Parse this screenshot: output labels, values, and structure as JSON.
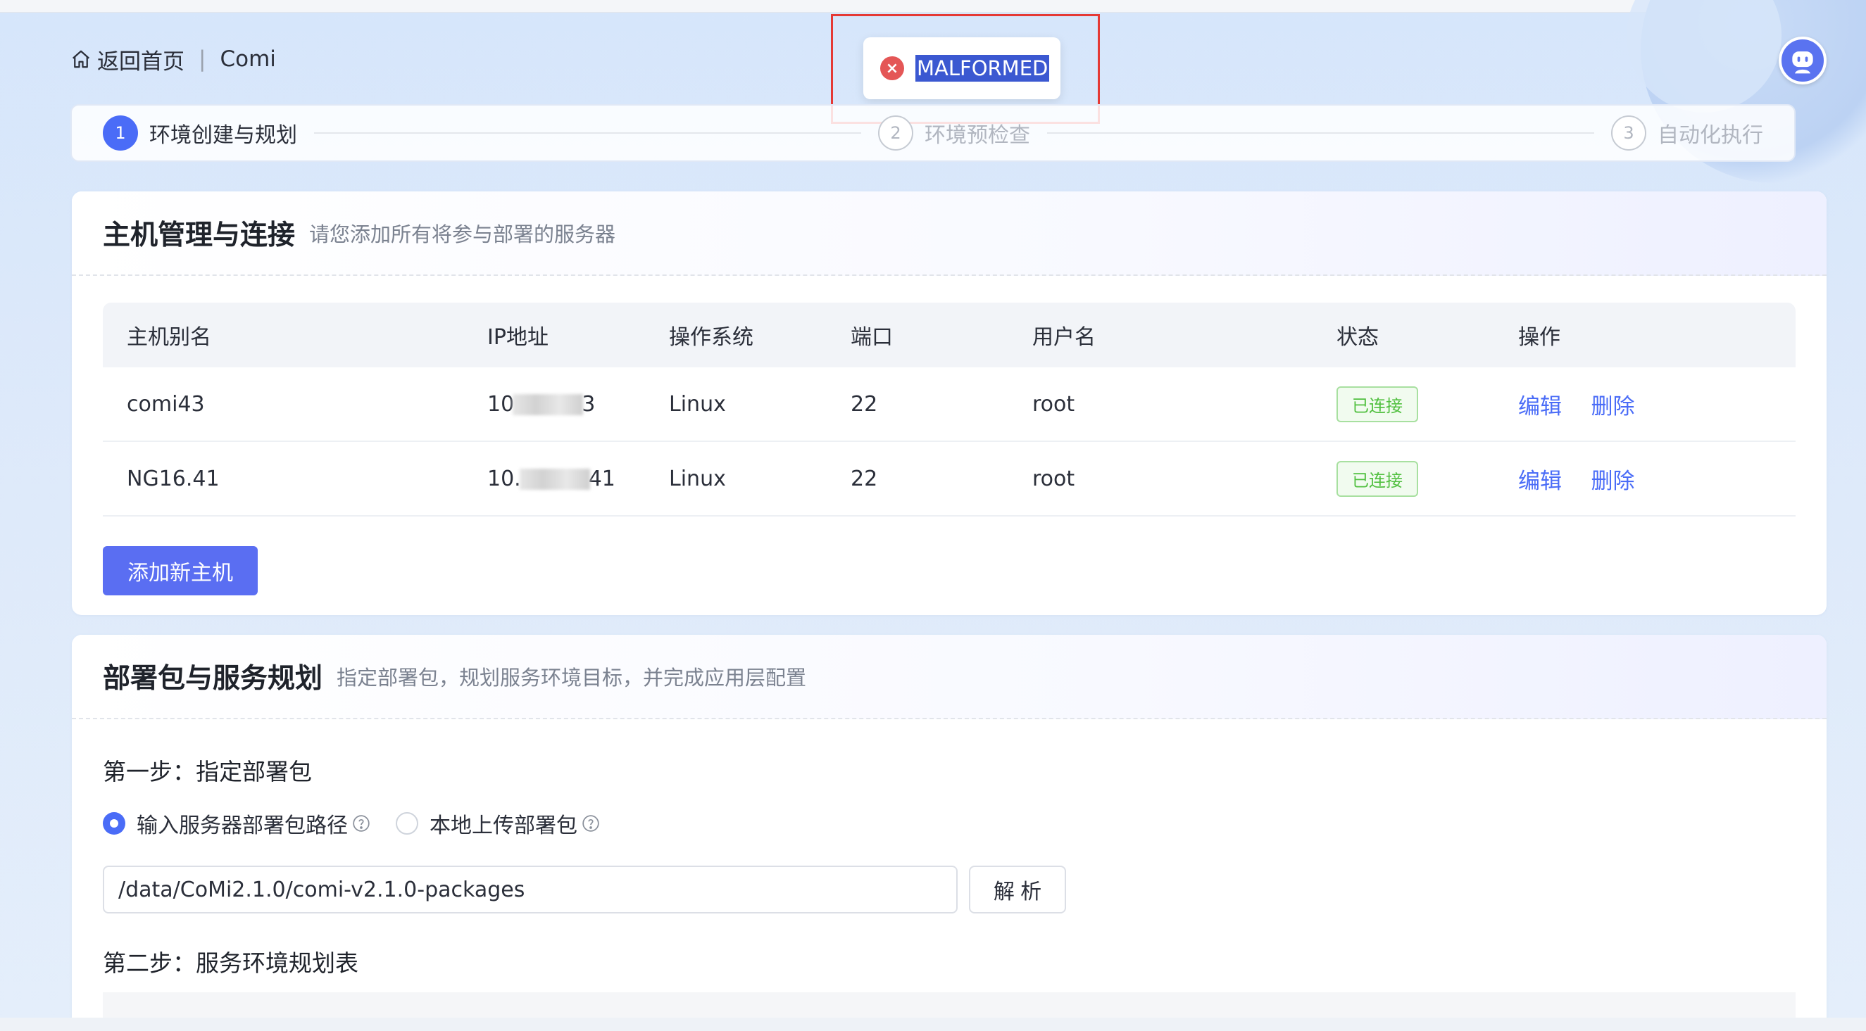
{
  "header": {
    "home_label": "返回首页",
    "separator": "|",
    "project_name": "Comi"
  },
  "toast": {
    "message": "MALFORMED",
    "icon": "error-circle-icon",
    "color": "#e45656"
  },
  "steps": [
    {
      "num": "1",
      "label": "环境创建与规划",
      "state": "active"
    },
    {
      "num": "2",
      "label": "环境预检查",
      "state": "inactive"
    },
    {
      "num": "3",
      "label": "自动化执行",
      "state": "inactive"
    }
  ],
  "host_card": {
    "title": "主机管理与连接",
    "subtitle": "请您添加所有将参与部署的服务器",
    "columns": [
      "主机别名",
      "IP地址",
      "操作系统",
      "端口",
      "用户名",
      "状态",
      "操作"
    ],
    "rows": [
      {
        "alias": "comi43",
        "ip_prefix": "10",
        "ip_suffix": "3",
        "os": "Linux",
        "port": "22",
        "user": "root",
        "status": "已连接",
        "edit": "编辑",
        "delete": "删除"
      },
      {
        "alias": "NG16.41",
        "ip_prefix": "10.",
        "ip_suffix": "41",
        "os": "Linux",
        "port": "22",
        "user": "root",
        "status": "已连接",
        "edit": "编辑",
        "delete": "删除"
      }
    ],
    "add_button": "添加新主机"
  },
  "plan_card": {
    "title": "部署包与服务规划",
    "subtitle": "指定部署包，规划服务环境目标，并完成应用层配置",
    "step1_title": "第一步：指定部署包",
    "radio_server_path": "输入服务器部署包路径",
    "radio_local_upload": "本地上传部署包",
    "path_value": "/data/CoMi2.1.0/comi-v2.1.0-packages",
    "parse_button": "解 析",
    "step2_title": "第二步：服务环境规划表"
  },
  "colors": {
    "accent": "#4a6cf7",
    "success": "#52c041",
    "error": "#e45656"
  }
}
